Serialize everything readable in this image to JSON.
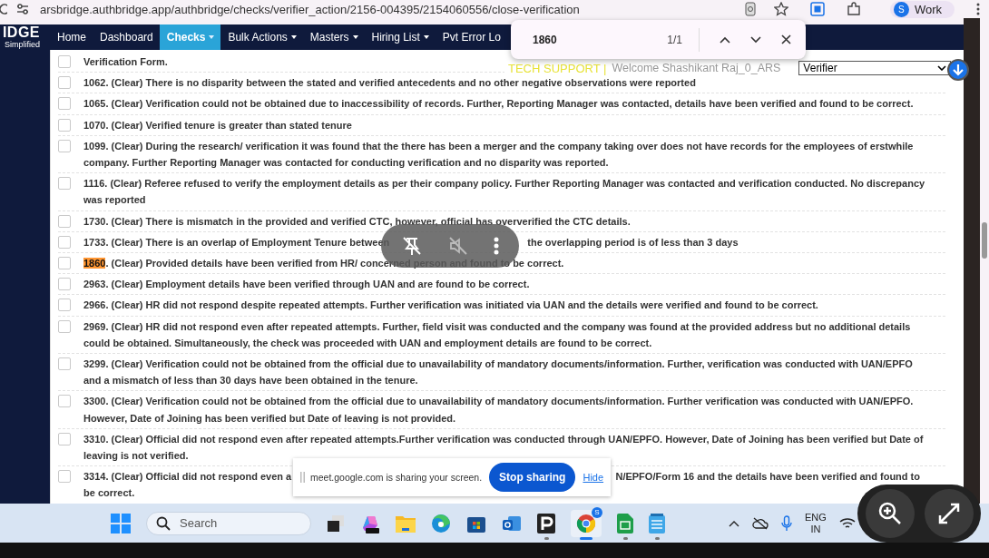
{
  "browser": {
    "url": "arsbridge.authbridge.app/authbridge/checks/verifier_action/2156-004395/2154060556/close-verification",
    "profile": {
      "initial": "S",
      "label": "Work"
    }
  },
  "logo": {
    "name": "IDGE",
    "tagline": "Simplified"
  },
  "nav": [
    {
      "label": "Home",
      "selected": false,
      "dropdown": false
    },
    {
      "label": "Dashboard",
      "selected": false,
      "dropdown": false
    },
    {
      "label": "Checks",
      "selected": true,
      "dropdown": true
    },
    {
      "label": "Bulk Actions",
      "selected": false,
      "dropdown": true
    },
    {
      "label": "Masters",
      "selected": false,
      "dropdown": true
    },
    {
      "label": "Hiring List",
      "selected": false,
      "dropdown": true
    },
    {
      "label": "Pvt Error Lo",
      "selected": false,
      "dropdown": false
    }
  ],
  "find_bar": {
    "query": "1860",
    "count": "1/1"
  },
  "header": {
    "tech_support": "TECH SUPPORT |",
    "welcome": "Welcome  Shashikant Raj_0_ARS",
    "role": "Verifier"
  },
  "rows": [
    {
      "kind": "plain",
      "text": "Verification Form.",
      "checked": false
    },
    {
      "kind": "plain",
      "code": "1062",
      "text": ". (Clear) There is no disparity between the stated and verified antecedents and no other negative observations were reported",
      "checked": false,
      "highlighted": false
    },
    {
      "kind": "plain",
      "code": "1065",
      "text": ". (Clear) Verification could not be obtained due to inaccessibility of records. Further, Reporting Manager was contacted, details have been verified and found to be correct.",
      "checked": false,
      "highlighted": false
    },
    {
      "kind": "plain",
      "code": "1070",
      "text": ". (Clear) Verified tenure is greater than stated tenure",
      "checked": false,
      "highlighted": false
    },
    {
      "kind": "plain",
      "code": "1099",
      "text": ". (Clear) During the research/ verification it was found that the there has been a merger and the company taking over does not have records for the employees of erstwhile company. Further Reporting Manager was contacted for conducting verification and no disparity was reported.",
      "checked": false,
      "highlighted": false
    },
    {
      "kind": "plain",
      "code": "1116",
      "text": ". (Clear) Referee refused to verify the employment details as per their company policy. Further Reporting Manager was contacted and verification conducted. No discrepancy was reported",
      "checked": false,
      "highlighted": false
    },
    {
      "kind": "plain",
      "code": "1730",
      "text": ". (Clear) There is mismatch in the provided and verified CTC, however, official has oververified the CTC details.",
      "checked": false,
      "highlighted": false
    },
    {
      "kind": "under_panel",
      "code": "1733",
      "text": ". (Clear) There is an overlap of Employment Tenure between",
      "tail": "the overlapping period is of less than 3 days",
      "checked": false,
      "highlighted": false
    },
    {
      "kind": "plain",
      "code": "1860",
      "text": ". (Clear) Provided details have been verified from HR/ concerned person and found to be correct.",
      "checked": false,
      "highlighted": true
    },
    {
      "kind": "plain",
      "code": "2963",
      "text": ". (Clear) Employment details have been verified through UAN and are found to be correct.",
      "checked": false,
      "highlighted": false
    },
    {
      "kind": "plain",
      "code": "2966",
      "text": ". (Clear) HR did not respond despite repeated attempts. Further verification was initiated via UAN and the details were verified and found to be correct.",
      "checked": false,
      "highlighted": false
    },
    {
      "kind": "plain",
      "code": "2969",
      "text": ". (Clear) HR did not respond even after repeated attempts. Further, field visit was conducted and the company was found at the provided address but no additional details could be obtained. Simultaneously, the check was proceeded with UAN and employment details are found to be correct.",
      "checked": false,
      "highlighted": false
    },
    {
      "kind": "plain",
      "code": "3299",
      "text": ". (Clear) Verification could not be obtained from the official due to unavailability of mandatory documents/information. Further, verification was conducted with UAN/EPFO and a mismatch of less than 30 days have been obtained in the tenure.",
      "checked": false,
      "highlighted": false
    },
    {
      "kind": "plain",
      "code": "3300",
      "text": ". (Clear) Verification could not be obtained from the official due to unavailability of mandatory documents/information. Further verification was conducted with UAN/EPFO. However, Date of Joining has been verified but Date of leaving is not provided.",
      "checked": false,
      "highlighted": false
    },
    {
      "kind": "plain",
      "code": "3310",
      "text": ". (Clear) Official did not respond even after repeated attempts.Further verification was conducted through UAN/EPFO. However, Date of Joining has been verified but Date of leaving is not verified.",
      "checked": false,
      "highlighted": false
    },
    {
      "kind": "under_bar",
      "code": "3314",
      "text": ". (Clear) Official did not respond even a",
      "tail": "N/EPFO/Form 16 and the details have been verified and found to",
      "more": "be correct.",
      "checked": false,
      "highlighted": false
    }
  ],
  "share_bar": {
    "message": "meet.google.com is sharing your screen.",
    "stop": "Stop sharing",
    "hide": "Hide"
  },
  "taskbar": {
    "search": "Search",
    "language": [
      "ENG",
      "IN"
    ],
    "chrome_badge": "S"
  }
}
